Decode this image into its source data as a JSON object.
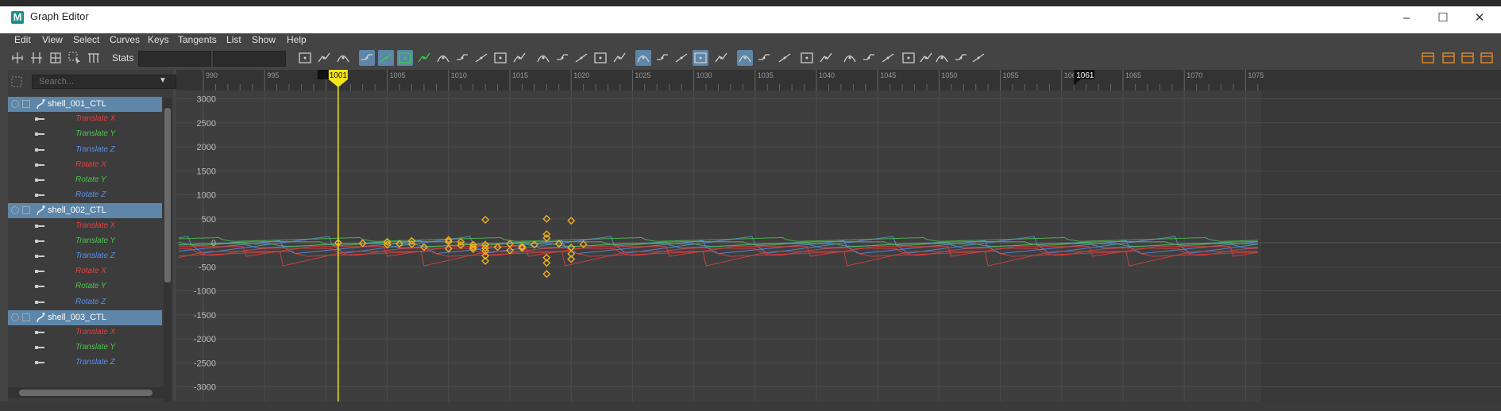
{
  "window": {
    "title": "Graph Editor",
    "app_icon_letter": "M"
  },
  "menu": [
    "Edit",
    "View",
    "Select",
    "Curves",
    "Keys",
    "Tangents",
    "List",
    "Show",
    "Help"
  ],
  "toolbar": {
    "stats_label": "Stats"
  },
  "search": {
    "placeholder": "Search..."
  },
  "outliner": [
    {
      "type": "node",
      "label": "shell_001_CTL"
    },
    {
      "type": "attr",
      "label": "Translate X",
      "color": "#e04040"
    },
    {
      "type": "attr",
      "label": "Translate Y",
      "color": "#4cc24c"
    },
    {
      "type": "attr",
      "label": "Translate Z",
      "color": "#5a8fe8"
    },
    {
      "type": "attr",
      "label": "Rotate X",
      "color": "#e04040"
    },
    {
      "type": "attr",
      "label": "Rotate Y",
      "color": "#4cc24c"
    },
    {
      "type": "attr",
      "label": "Rotate Z",
      "color": "#5a8fe8"
    },
    {
      "type": "node",
      "label": "shell_002_CTL"
    },
    {
      "type": "attr",
      "label": "Translate X",
      "color": "#e04040"
    },
    {
      "type": "attr",
      "label": "Translate Y",
      "color": "#4cc24c"
    },
    {
      "type": "attr",
      "label": "Translate Z",
      "color": "#5a8fe8"
    },
    {
      "type": "attr",
      "label": "Rotate X",
      "color": "#e04040"
    },
    {
      "type": "attr",
      "label": "Rotate Y",
      "color": "#4cc24c"
    },
    {
      "type": "attr",
      "label": "Rotate Z",
      "color": "#5a8fe8"
    },
    {
      "type": "node",
      "label": "shell_003_CTL"
    },
    {
      "type": "attr",
      "label": "Translate X",
      "color": "#e04040"
    },
    {
      "type": "attr",
      "label": "Translate Y",
      "color": "#4cc24c"
    },
    {
      "type": "attr",
      "label": "Translate Z",
      "color": "#5a8fe8"
    }
  ],
  "graph": {
    "frame_ticks": [
      "990",
      "995",
      "1000",
      "1005",
      "1010",
      "1015",
      "1020",
      "1025",
      "1030",
      "1035",
      "1040",
      "1045",
      "1050",
      "1055",
      "1060",
      "1065",
      "1070",
      "1075"
    ],
    "value_ticks": [
      "3000",
      "2500",
      "2000",
      "1500",
      "1000",
      "500",
      "0",
      "-500",
      "-1000",
      "-1500",
      "-2000",
      "-2500",
      "-3000"
    ],
    "current_frame": "1001",
    "end_frame": "1061",
    "colors": {
      "current_frame_line": "#f2e31a",
      "key": "#f0b020",
      "translate_x": "#e04040",
      "translate_y": "#4cc24c",
      "translate_z": "#5a8fe8"
    }
  }
}
